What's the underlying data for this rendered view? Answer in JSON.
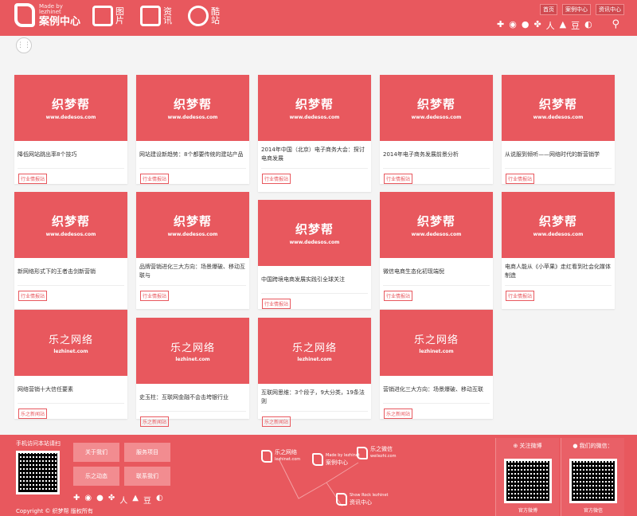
{
  "header": {
    "logo_small_1": "Made by",
    "logo_small_2": "lezhinet",
    "logo_title": "案例中心",
    "nav": [
      {
        "label": "图片",
        "icon": "image-icon"
      },
      {
        "label": "资讯",
        "icon": "document-icon"
      },
      {
        "label": "酷站",
        "icon": "link-icon"
      }
    ],
    "top_links": [
      "首页",
      "案例中心",
      "资讯中心"
    ],
    "social_icons": [
      "plus-icon",
      "weibo-icon",
      "wechat-icon",
      "clover-icon",
      "renren-icon",
      "a-icon",
      "douban-icon",
      "circle-icon"
    ]
  },
  "cards": [
    {
      "brand": "dedesos",
      "title": "降低网站跳出率8个技巧",
      "tag": "行业情报站"
    },
    {
      "brand": "dedesos",
      "title": "网站建设新趋势：8个都要传统的建站产品",
      "tag": "行业情报站"
    },
    {
      "brand": "dedesos",
      "title": "2014年中国（北京）电子商务大会：探讨电商发展",
      "tag": "行业情报站"
    },
    {
      "brand": "dedesos",
      "title": "2014年电子商务发展前景分析",
      "tag": "行业情报站"
    },
    {
      "brand": "dedesos",
      "title": "从说服到倾听——网络时代的新营销学",
      "tag": "行业情报站"
    },
    {
      "brand": "dedesos",
      "title": "新网络形式下的王者击剑新营销",
      "tag": "行业情报站"
    },
    {
      "brand": "dedesos",
      "title": "品牌营销进化三大方向：场景爆破、移动互联与",
      "tag": "行业情报站"
    },
    {
      "brand": "dedesos",
      "title": "中国跨境电商发展实践引全球关注",
      "tag": "行业情报站"
    },
    {
      "brand": "dedesos",
      "title": "微信电商生态化初现端倪",
      "tag": "行业情报站"
    },
    {
      "brand": "dedesos",
      "title": "电商人能从《小苹果》走红看到社会化媒体制造",
      "tag": "行业情报站"
    },
    {
      "brand": "lezhi",
      "title": "网络营销十大信任要素",
      "tag": "乐之新闻站"
    },
    {
      "brand": "lezhi",
      "title": "史玉柱：互联网金融不会击垮银行业",
      "tag": "乐之新闻站"
    },
    {
      "brand": "lezhi",
      "title": "互联网思维：3个段子，9大分类，19条法则",
      "tag": "乐之新闻站"
    },
    {
      "brand": "lezhi",
      "title": "营销进化三大方向：场景爆破、移动互联",
      "tag": "乐之新闻站"
    }
  ],
  "brands": {
    "dedesos": {
      "title": "织梦帮",
      "sub": "www.dedesos.com"
    },
    "lezhi": {
      "title": "乐之网络",
      "sub": "lezhinet.com"
    }
  },
  "footer": {
    "qr_title": "手机访问本站请扫",
    "buttons": [
      "关于我们",
      "服务项目",
      "乐之动态",
      "联系我们"
    ],
    "copyright": "Copyright © 织梦帮 版权所有",
    "networks": [
      {
        "title": "乐之网络",
        "sub": "lezhinet.com"
      },
      {
        "title": "案例中心",
        "sub": "Made by lezhinet"
      },
      {
        "title": "乐之微信",
        "sub": "weilezhi.com"
      },
      {
        "title": "资讯中心",
        "sub": "Show Rock lezhinet"
      }
    ],
    "weibo_title": "关注微博",
    "weibo_caption": "官方微博",
    "wechat_title": "我们的微信：",
    "wechat_caption": "官方微信"
  },
  "colors": {
    "brand": "#e8585e",
    "footer_button": "#f28c90"
  }
}
